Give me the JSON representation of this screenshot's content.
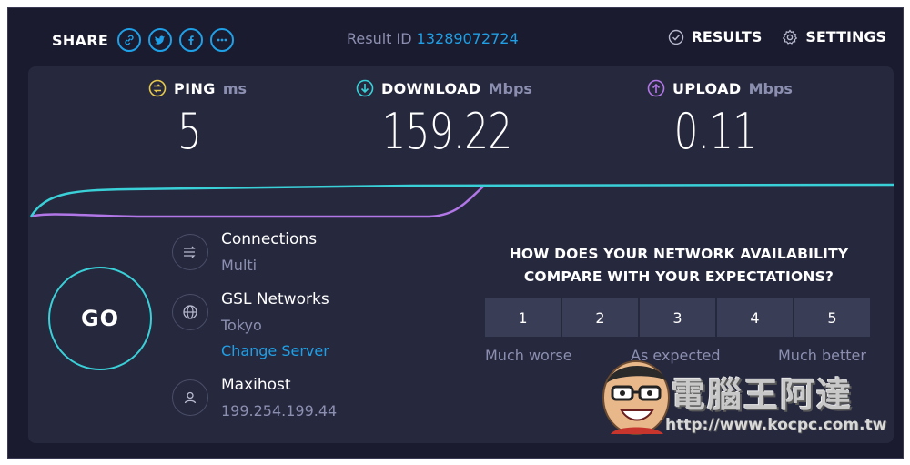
{
  "header": {
    "share_label": "SHARE",
    "share_icons": [
      "link-icon",
      "twitter-icon",
      "facebook-icon",
      "more-icon"
    ],
    "result_id_label": "Result ID",
    "result_id": "13289072724",
    "results_label": "RESULTS",
    "settings_label": "SETTINGS"
  },
  "metrics": {
    "ping": {
      "name": "PING",
      "unit": "ms",
      "value": "5",
      "color": "#e6c84a"
    },
    "download": {
      "name": "DOWNLOAD",
      "unit": "Mbps",
      "value": "159.22",
      "color": "#3ad0d8"
    },
    "upload": {
      "name": "UPLOAD",
      "unit": "Mbps",
      "value": "0.11",
      "color": "#b277e6"
    }
  },
  "go_label": "GO",
  "connection": {
    "connections_title": "Connections",
    "connections_value": "Multi",
    "server_title": "GSL Networks",
    "server_location": "Tokyo",
    "change_server": "Change Server",
    "host_title": "Maxihost",
    "host_ip": "199.254.199.44"
  },
  "survey": {
    "question_line1": "HOW DOES YOUR NETWORK AVAILABILITY",
    "question_line2": "COMPARE WITH YOUR EXPECTATIONS?",
    "options": [
      "1",
      "2",
      "3",
      "4",
      "5"
    ],
    "label_low": "Much worse",
    "label_mid": "As expected",
    "label_high": "Much better"
  },
  "watermark": {
    "text": "電腦王阿達",
    "url": "http://www.kocpc.com.tw"
  },
  "colors": {
    "accent": "#1fa0e6",
    "download_line": "#3ad0d8",
    "upload_line": "#b277e6",
    "background": "#1b1b2f",
    "card": "#26283e"
  }
}
